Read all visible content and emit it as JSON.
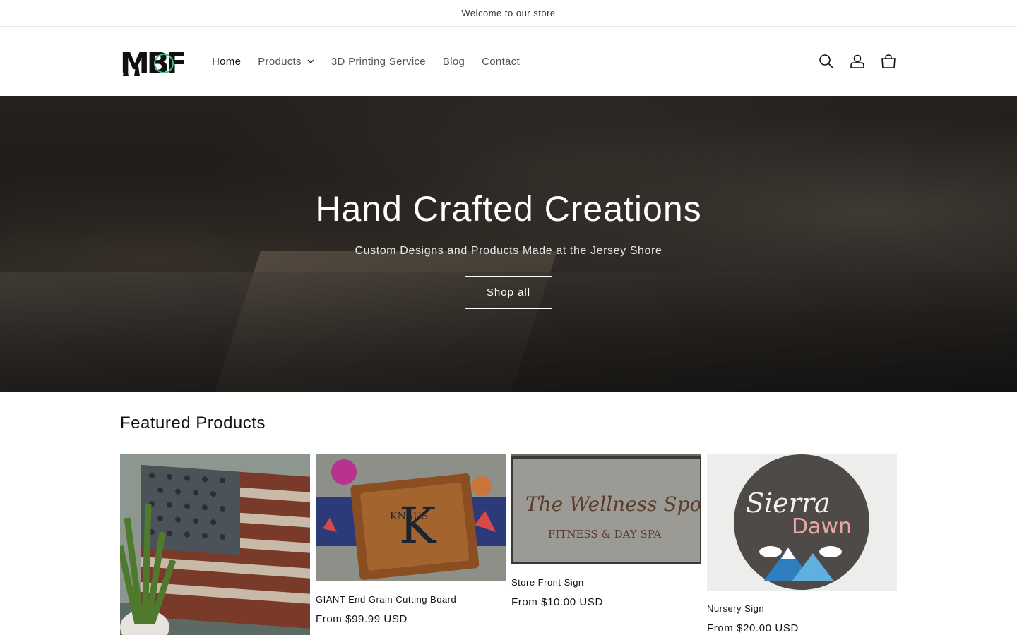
{
  "announcement": {
    "text": "Welcome to our store"
  },
  "header": {
    "logo_text": "MBF",
    "nav": [
      {
        "label": "Home",
        "active": true
      },
      {
        "label": "Products",
        "dropdown": true
      },
      {
        "label": "3D Printing Service"
      },
      {
        "label": "Blog"
      },
      {
        "label": "Contact"
      }
    ],
    "icons": [
      "search-icon",
      "account-icon",
      "cart-icon"
    ]
  },
  "hero": {
    "title": "Hand Crafted Creations",
    "subtitle": "Custom Designs and Products Made at the Jersey Shore",
    "button_label": "Shop all"
  },
  "featured": {
    "title": "Featured Products",
    "products": [
      {
        "name": "",
        "price": ""
      },
      {
        "name": "GIANT End Grain Cutting Board",
        "price": "From $99.99 USD"
      },
      {
        "name": "Store Front Sign",
        "price": "From $10.00 USD"
      },
      {
        "name": "Nursery Sign",
        "price": "From $20.00 USD"
      }
    ]
  },
  "image_text": {
    "cutting_board_letter": "K",
    "cutting_board_name": "KNAUS",
    "store_sign_script": "The Wellness Spot",
    "store_sign_caption": "FITNESS & DAY SPA",
    "nursery_line1": "Sierra",
    "nursery_line2": "Dawn"
  },
  "colors": {
    "text": "#121212",
    "nav_muted": "#555555",
    "logo_accent": "#3cc07a"
  }
}
